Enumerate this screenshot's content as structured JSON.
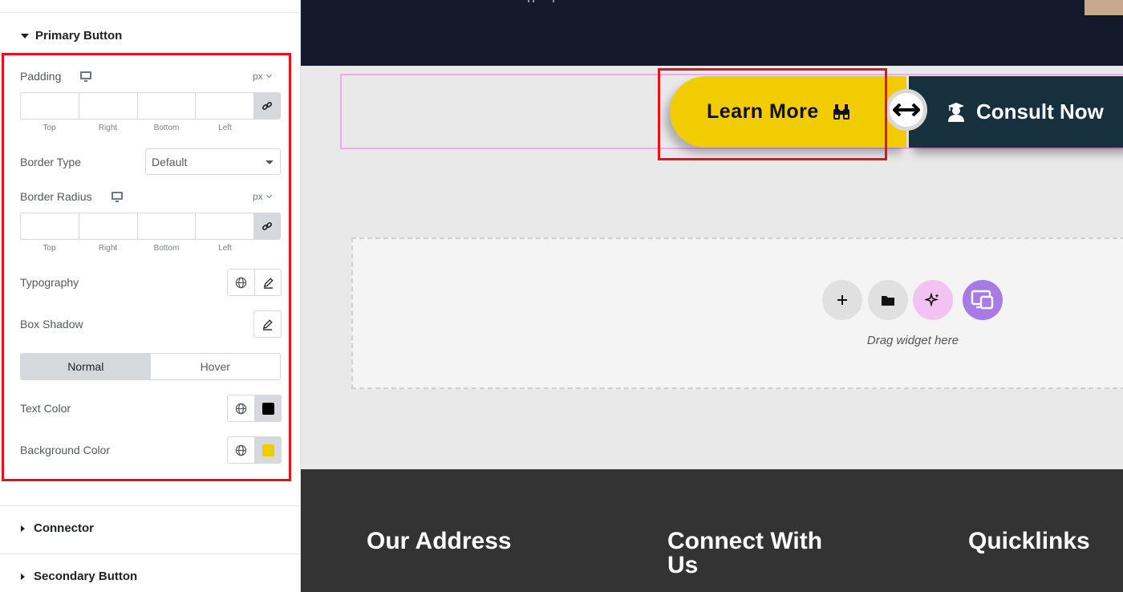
{
  "panel": {
    "sections": {
      "primary": "Primary Button",
      "connector": "Connector",
      "secondary": "Secondary Button"
    },
    "padding": {
      "label": "Padding",
      "unit": "px",
      "sides": [
        "Top",
        "Right",
        "Bottom",
        "Left"
      ]
    },
    "border_type": {
      "label": "Border Type",
      "value": "Default"
    },
    "border_radius": {
      "label": "Border Radius",
      "unit": "px",
      "sides": [
        "Top",
        "Right",
        "Bottom",
        "Left"
      ]
    },
    "typography": {
      "label": "Typography"
    },
    "box_shadow": {
      "label": "Box Shadow"
    },
    "state_tabs": {
      "normal": "Normal",
      "hover": "Hover",
      "active": "normal"
    },
    "text_color": {
      "label": "Text Color",
      "value": "#000000"
    },
    "background_color": {
      "label": "Background Color",
      "value": "#f0cc00"
    }
  },
  "canvas": {
    "buttons": {
      "learn_more": "Learn More",
      "consult_now": "Consult Now"
    },
    "drop_zone": {
      "hint": "Drag widget here"
    },
    "footer": {
      "col1": "Our Address",
      "col2": "Connect With Us",
      "col3": "Quicklinks"
    }
  },
  "colors": {
    "accent_yellow": "#f0cc00",
    "navy": "#16303e",
    "highlight_red": "#e8101b",
    "ai_pink": "#f3c2f3",
    "template_purple": "#a77be4"
  }
}
